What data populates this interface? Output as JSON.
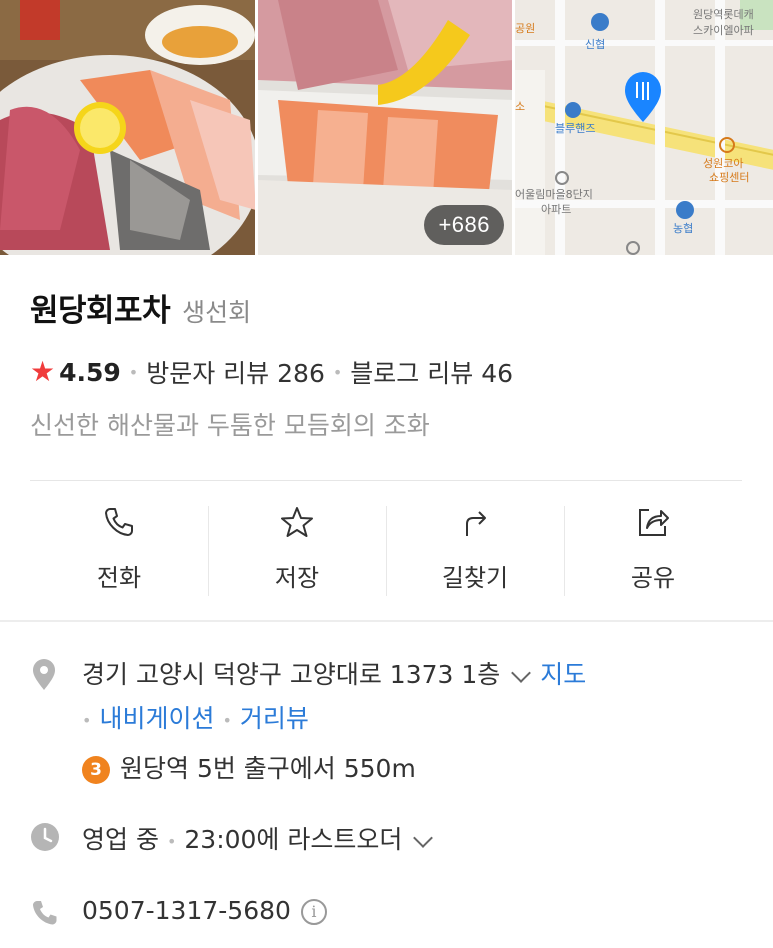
{
  "photos": {
    "more_count": "+686",
    "map_labels": {
      "top_left": "공원",
      "station_top": "신협",
      "station_right_1": "원당역롯데캐",
      "station_right_2": "스카이엘아파",
      "left_edge": "소",
      "bluehands": "블루핸즈",
      "seongwon_1": "성원코아",
      "seongwon_2": "쇼핑센터",
      "apt_1": "어울림마을8단지",
      "apt_2": "아파트",
      "nonghyup": "농협"
    },
    "map_pin_color": "#1a85ff"
  },
  "place": {
    "name": "원당회포차",
    "category": "생선회",
    "rating": "4.59",
    "visitor_reviews": "방문자 리뷰 286",
    "blog_reviews": "블로그 리뷰 46",
    "tagline": "신선한 해산물과 두툼한 모듬회의 조화"
  },
  "actions": [
    {
      "label": "전화",
      "icon": "phone-icon"
    },
    {
      "label": "저장",
      "icon": "star-outline-icon"
    },
    {
      "label": "길찾기",
      "icon": "directions-arrow-icon"
    },
    {
      "label": "공유",
      "icon": "share-icon"
    }
  ],
  "info": {
    "address": "경기 고양시 덕양구 고양대로 1373 1층",
    "map_link": "지도",
    "navigation_link": "내비게이션",
    "street_view_link": "거리뷰",
    "subway_line": "3",
    "subway_text": "원당역 5번 출구에서 550m",
    "hours_status": "영업 중",
    "hours_detail": "23:00에 라스트오더",
    "phone": "0507-1317-5680"
  },
  "colors": {
    "star": "#f03c3c",
    "link": "#2b7bd8",
    "subway_line_3": "#f0831e"
  }
}
